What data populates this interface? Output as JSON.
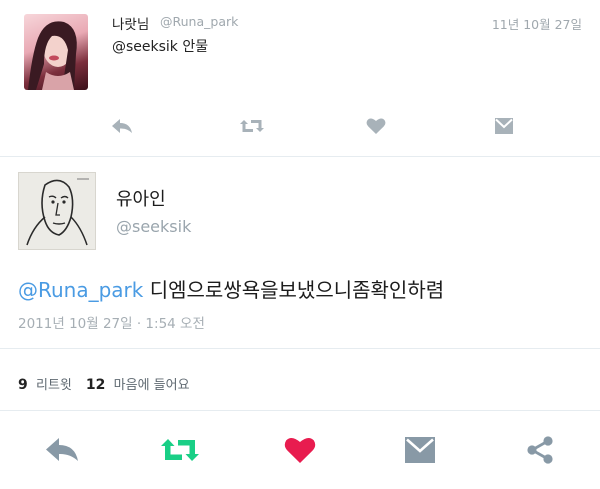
{
  "reply_tweet": {
    "display_name": "나랏님",
    "handle": "@Runa_park",
    "date": "11년 10월 27일",
    "text": "@seeksik 안물"
  },
  "main_tweet": {
    "display_name": "유아인",
    "handle": "@seeksik",
    "mention": "@Runa_park",
    "body": " 디엠으로쌍욕을보냈으니좀확인하렴",
    "timestamp": "2011년 10월 27일 · 1:54 오전",
    "stats": {
      "retweet_count": "9",
      "retweet_label": "리트윗",
      "like_count": "12",
      "like_label": "마음에 들어요"
    }
  },
  "icons": {
    "reply": "reply-icon",
    "retweet": "retweet-icon",
    "like": "heart-icon",
    "dm": "envelope-icon",
    "share": "share-icon"
  },
  "colors": {
    "retweet_active": "#19cf86",
    "like_active": "#e81c4f",
    "icon_gray": "#a8b2b9",
    "icon_dark": "#8899a6",
    "link_blue": "#4a9be3"
  }
}
